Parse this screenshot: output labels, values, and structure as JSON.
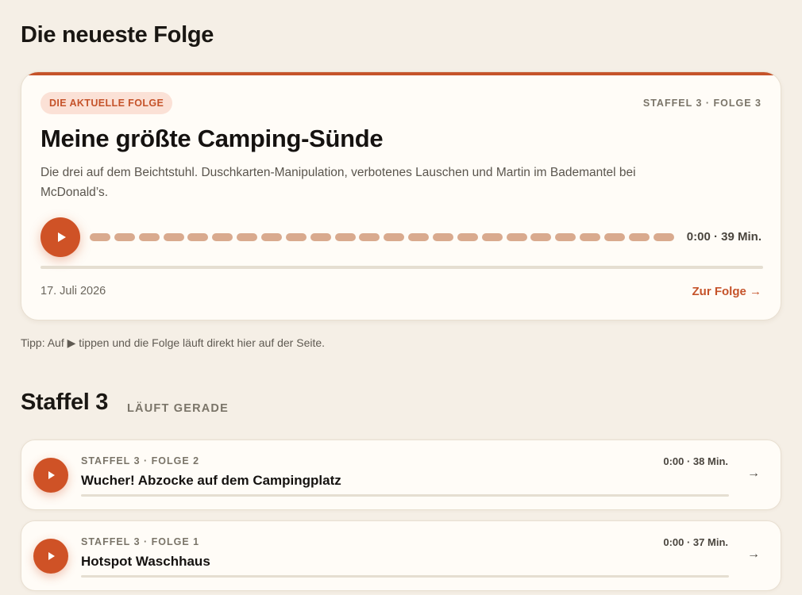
{
  "latest": {
    "heading": "Die neueste Folge",
    "badge": "DIE AKTUELLE FOLGE",
    "episode_meta": "STAFFEL 3 · FOLGE 3",
    "title": "Meine größte Camping-Sünde",
    "description": "Die drei auf dem Beichtstuhl. Duschkarten-Manipulation, verbotenes Lauschen und Martin im Bademantel bei McDonald’s.",
    "time": "0:00 · 39 Min.",
    "date": "17. Juli 2026",
    "link_label": "Zur Folge →",
    "progress": 0,
    "play_icon": "play-icon"
  },
  "tip": "Tipp: Auf ▶ tippen und die Folge läuft direkt hier auf der Seite.",
  "season": {
    "title": "Staffel 3",
    "subtitle": "LÄUFT GERADE",
    "episodes": [
      {
        "meta": "STAFFEL 3 · FOLGE 2",
        "title": "Wucher! Abzocke auf dem Campingplatz",
        "time": "0:00 · 38 Min.",
        "progress": 0
      },
      {
        "meta": "STAFFEL 3 · FOLGE 1",
        "title": "Hotspot Waschhaus",
        "time": "0:00 · 37 Min.",
        "progress": 0
      }
    ]
  },
  "colors": {
    "accent": "#cf5226",
    "background": "#f5efe6",
    "card": "#fffcf7",
    "waveform": "#d9aa8e"
  }
}
